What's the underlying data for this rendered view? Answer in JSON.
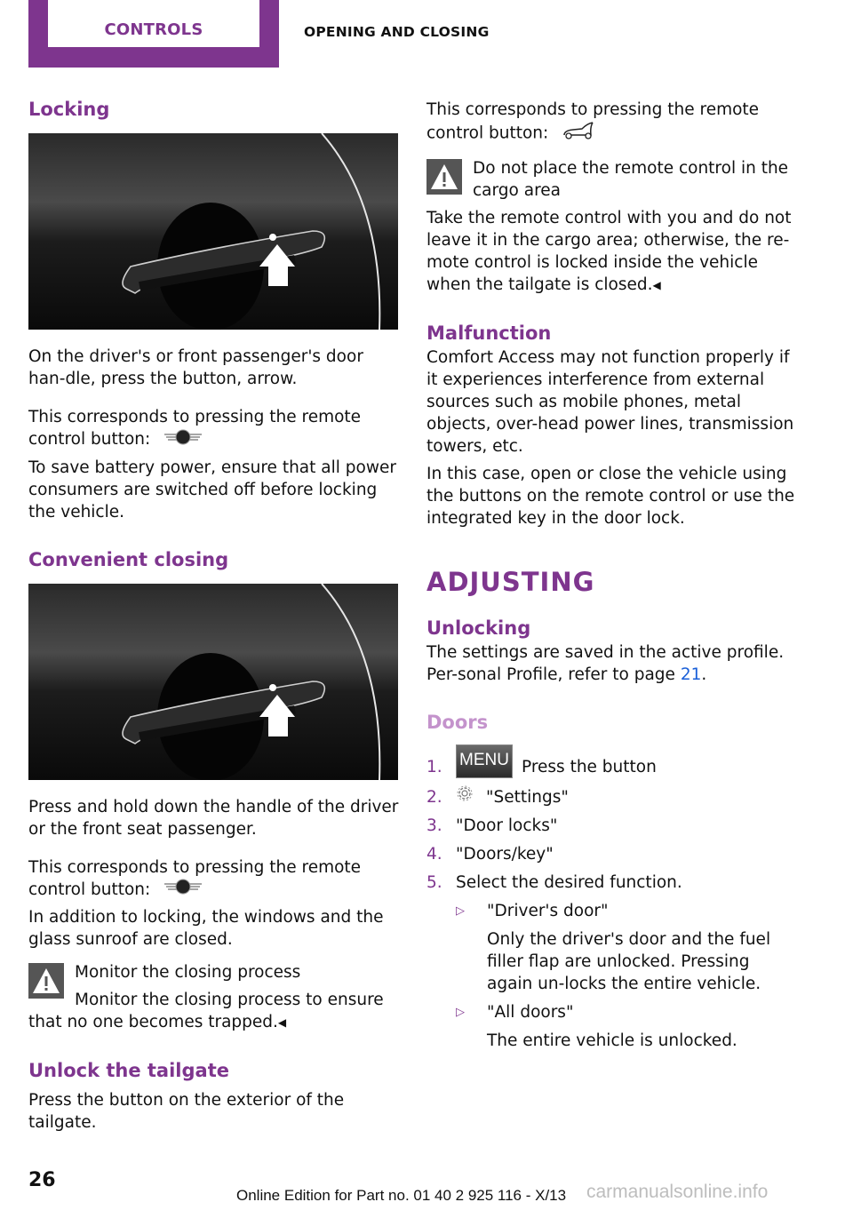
{
  "header": {
    "chapter_tab": "CONTROLS",
    "section": "OPENING AND CLOSING"
  },
  "colors": {
    "accent": "#7e358e",
    "accent_light": "#c493cc",
    "link": "#1a5fd8",
    "warning_bg": "#555555"
  },
  "left": {
    "locking": {
      "heading": "Locking",
      "image_alt": "door-handle-button-arrow",
      "p1": "On the driver's or front passenger's door han-dle, press the button, arrow.",
      "p2": "This corresponds to pressing the remote control button:",
      "p2_icon": "mini-logo-icon",
      "p3": "To save battery power, ensure that all power consumers are switched off before locking the vehicle."
    },
    "convenient_closing": {
      "heading": "Convenient closing",
      "image_alt": "door-handle-button-arrow",
      "p1": "Press and hold down the handle of the driver or the front seat passenger.",
      "p2": "This corresponds to pressing the remote control button:",
      "p2_icon": "mini-logo-icon",
      "p3": "In addition to locking, the windows and the glass sunroof are closed.",
      "warning": {
        "title": "Monitor the closing process",
        "body": "Monitor the closing process to ensure that no one becomes trapped.",
        "end_mark": "◀"
      }
    },
    "unlock_tailgate": {
      "heading": "Unlock the tailgate",
      "p1": "Press the button on the exterior of the tailgate."
    }
  },
  "right": {
    "tailgate_cont": {
      "p1": "This corresponds to pressing the remote control button:",
      "p1_icon": "tailgate-icon",
      "warning": {
        "title": "Do not place the remote control in the cargo area",
        "body": "Take the remote control with you and do not leave it in the cargo area; otherwise, the re-mote control is locked inside the vehicle when the tailgate is closed.",
        "end_mark": "◀"
      }
    },
    "malfunction": {
      "heading": "Malfunction",
      "p1": "Comfort Access may not function properly if it experiences interference from external sources such as mobile phones, metal objects, over-head power lines, transmission towers, etc.",
      "p2": "In this case, open or close the vehicle using the buttons on the remote control or use the integrated key in the door lock."
    },
    "adjusting": {
      "heading": "ADJUSTING",
      "unlocking": {
        "heading": "Unlocking",
        "p1_before": "The settings are saved in the active profile. Per-sonal Profile, refer to page ",
        "p1_link": "21",
        "p1_after": "."
      },
      "doors": {
        "heading": "Doors",
        "steps": [
          {
            "num": "1.",
            "button": "MENU",
            "text": "Press the button"
          },
          {
            "num": "2.",
            "icon": "settings-gear-icon",
            "text": "\"Settings\""
          },
          {
            "num": "3.",
            "text": "\"Door locks\""
          },
          {
            "num": "4.",
            "text": "\"Doors/key\""
          },
          {
            "num": "5.",
            "text": "Select the desired function."
          }
        ],
        "options": [
          {
            "marker": "▷",
            "label": "\"Driver's door\"",
            "desc": "Only the driver's door and the fuel filler flap are unlocked. Pressing again un-locks the entire vehicle."
          },
          {
            "marker": "▷",
            "label": "\"All doors\"",
            "desc": "The entire vehicle is unlocked."
          }
        ]
      }
    }
  },
  "footer": {
    "page_number": "26",
    "edition": "Online Edition for Part no. 01 40 2 925 116 - X/13",
    "watermark": "carmanualsonline.info"
  }
}
